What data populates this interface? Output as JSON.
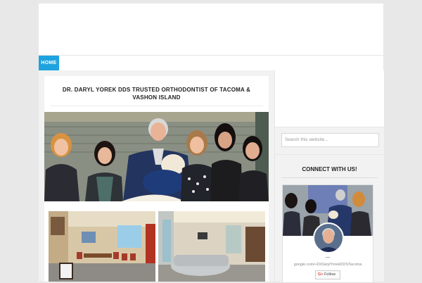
{
  "nav": {
    "items": [
      {
        "label": "HOME"
      }
    ]
  },
  "post": {
    "title": "DR. DARYL YOREK DDS TRUSTED ORTHODONTIST OF TACOMA & VASHON ISLAND"
  },
  "sidebar": {
    "search": {
      "placeholder": "Search this website..."
    },
    "connect": {
      "title": "CONNECT WITH US!",
      "google_card": {
        "name": "—",
        "url": "google.com/+DrDarylYorekDDSTacoma",
        "follow_label": "Follow",
        "gplus_label": "G+"
      }
    }
  },
  "colors": {
    "accent": "#1ea3e0",
    "page_bg": "#e8e8e8",
    "panel_bg": "#f2f2f2"
  }
}
